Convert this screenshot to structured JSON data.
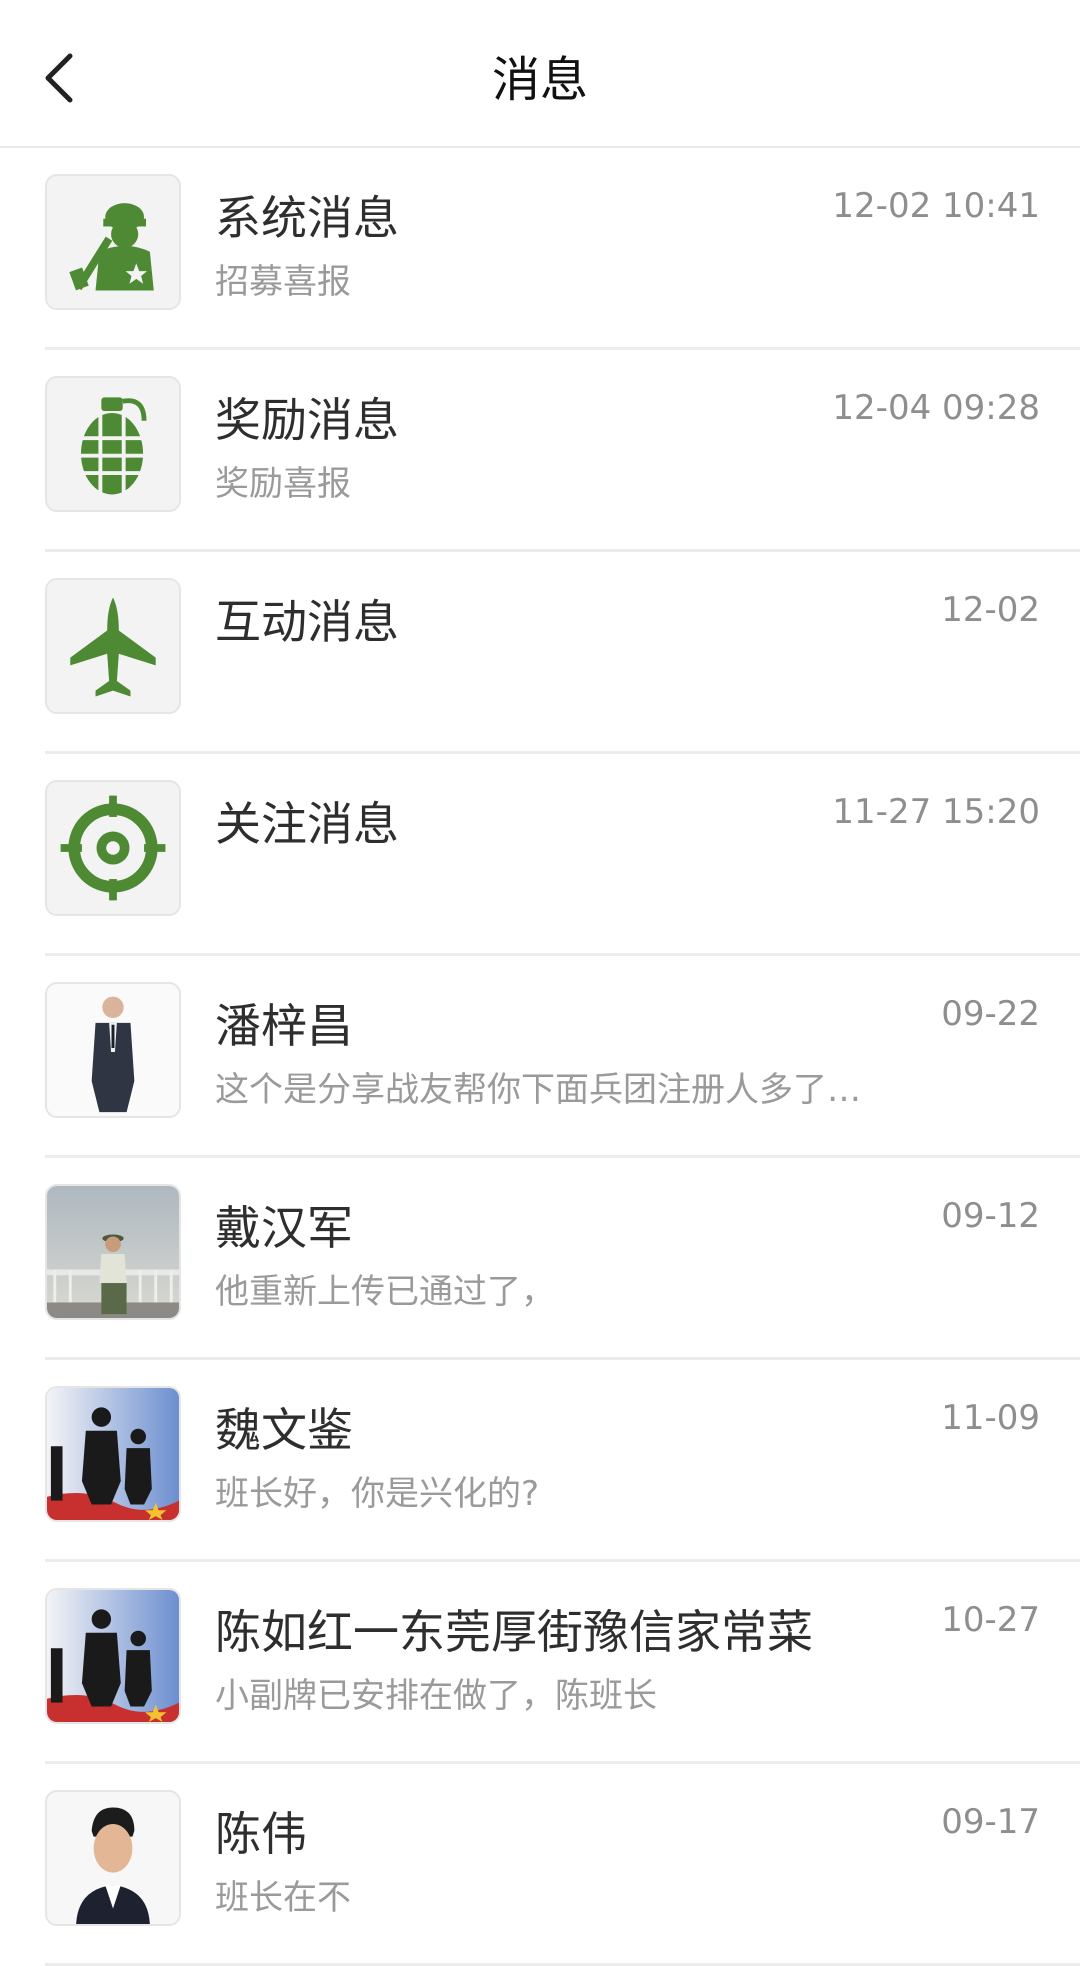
{
  "header": {
    "title": "消息"
  },
  "messages": [
    {
      "name": "系统消息",
      "preview": "招募喜报",
      "time": "12-02 10:41",
      "icon": "soldier-icon"
    },
    {
      "name": "奖励消息",
      "preview": "奖励喜报",
      "time": "12-04 09:28",
      "icon": "grenade-icon"
    },
    {
      "name": "互动消息",
      "preview": "",
      "time": "12-02",
      "icon": "fighter-jet-icon"
    },
    {
      "name": "关注消息",
      "preview": "",
      "time": "11-27 15:20",
      "icon": "target-icon"
    },
    {
      "name": "潘梓昌",
      "preview": "这个是分享战友帮你下面兵团注册人多了…",
      "time": "09-22",
      "icon": "avatar-suit-man"
    },
    {
      "name": "戴汉军",
      "preview": "他重新上传已通过了，",
      "time": "09-12",
      "icon": "avatar-soldier-bridge"
    },
    {
      "name": "魏文鉴",
      "preview": "班长好，你是兴化的?",
      "time": "11-09",
      "icon": "avatar-soldiers-silhouette"
    },
    {
      "name": "陈如红一东莞厚街豫信家常菜",
      "preview": "小副牌已安排在做了，陈班长",
      "time": "10-27",
      "icon": "avatar-soldiers-silhouette"
    },
    {
      "name": "陈伟",
      "preview": "班长在不",
      "time": "09-17",
      "icon": "avatar-man-portrait"
    }
  ],
  "colors": {
    "icon_green": "#4e8a34",
    "divider": "#ececec",
    "time": "#8e8e8e",
    "preview": "#9a9a9a"
  }
}
